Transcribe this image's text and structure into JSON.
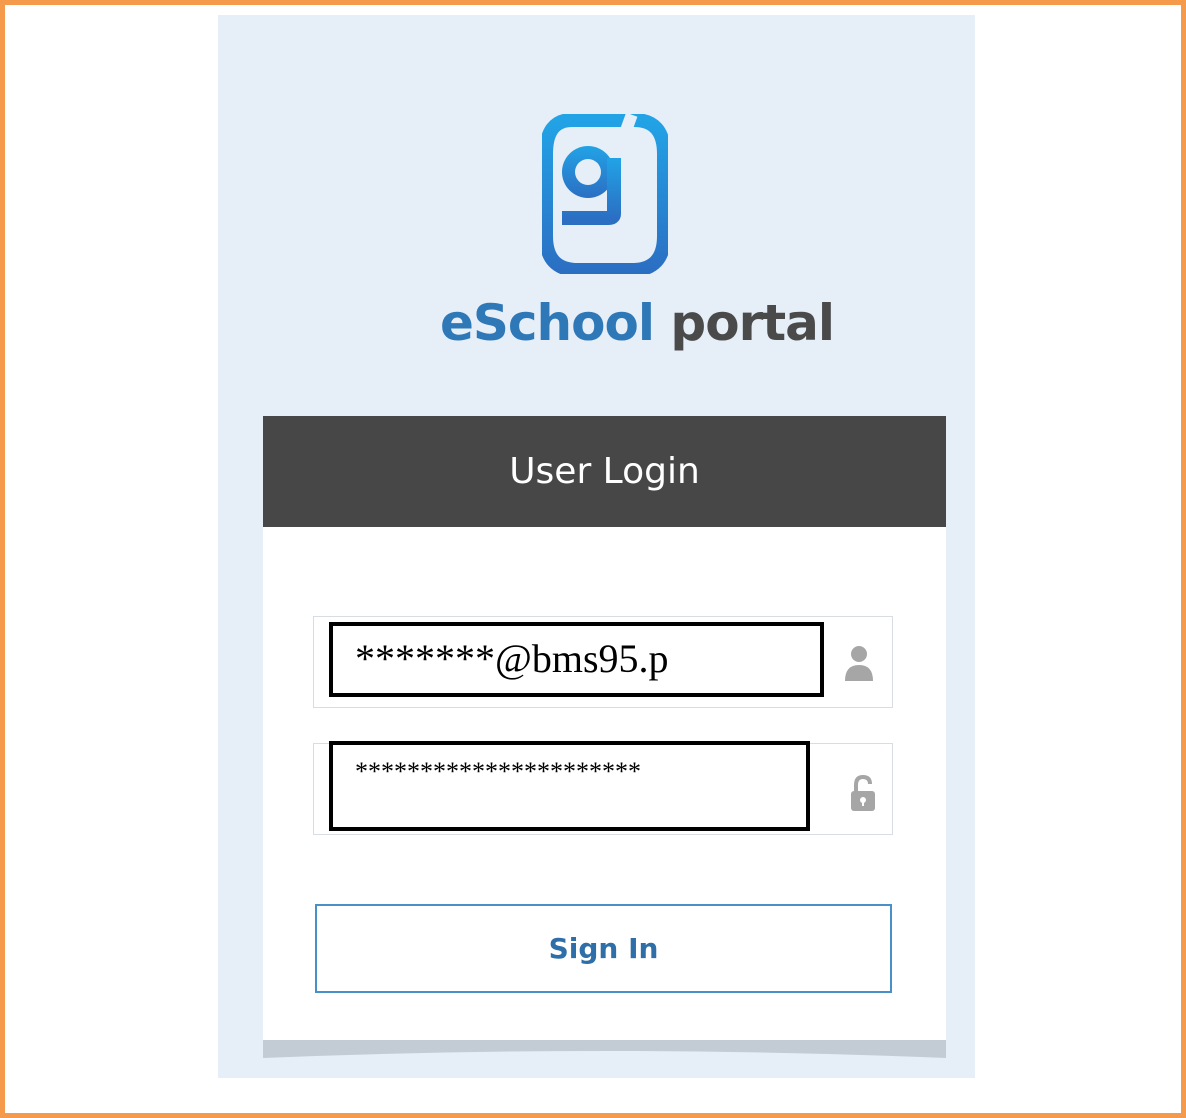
{
  "brand": {
    "name_part1": "eSchool",
    "name_part2": "portal",
    "logo_icon": "eschool-g-logo",
    "colors": {
      "primary": "#2f78b8",
      "secondary": "#4a4a4a",
      "logo_gradient": [
        "#1f9de0",
        "#2d6fc2"
      ]
    }
  },
  "frame": {
    "border_color": "#f59a4a",
    "panel_background": "#e6eef7"
  },
  "login": {
    "header_title": "User Login",
    "header_background": "#474747",
    "username": {
      "value": "*******@bms95.p",
      "icon": "user-icon"
    },
    "password": {
      "value": "**********************",
      "icon": "lock-icon"
    },
    "signin_label": "Sign In",
    "signin_color": "#2f6fa9"
  }
}
